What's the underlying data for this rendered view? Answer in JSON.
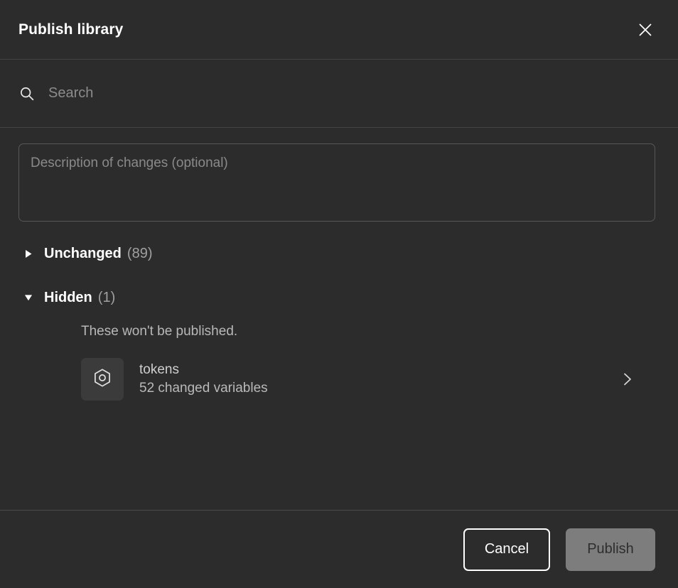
{
  "dialog": {
    "title": "Publish library",
    "close_icon": "close-icon"
  },
  "search": {
    "icon": "search-icon",
    "placeholder": "Search",
    "value": ""
  },
  "description": {
    "placeholder": "Description of changes (optional)",
    "value": ""
  },
  "sections": [
    {
      "name": "unchanged",
      "title": "Unchanged",
      "count": "(89)",
      "expanded": false,
      "caret_icon": "caret-right-icon"
    },
    {
      "name": "hidden",
      "title": "Hidden",
      "count": "(1)",
      "expanded": true,
      "caret_icon": "caret-down-icon",
      "note": "These won't be published.",
      "items": [
        {
          "thumb_icon": "variables-hexagon-icon",
          "title": "tokens",
          "subtitle": "52 changed variables",
          "chevron_icon": "chevron-right-icon"
        }
      ]
    }
  ],
  "footer": {
    "cancel_label": "Cancel",
    "publish_label": "Publish"
  },
  "colors": {
    "background": "#2c2c2c",
    "divider": "#444444",
    "text_primary": "#ffffff",
    "text_secondary": "#b8b8b8",
    "placeholder": "#8c8c8c",
    "publish_button_bg": "#7d7d7d",
    "thumb_bg": "#3b3b3b"
  }
}
